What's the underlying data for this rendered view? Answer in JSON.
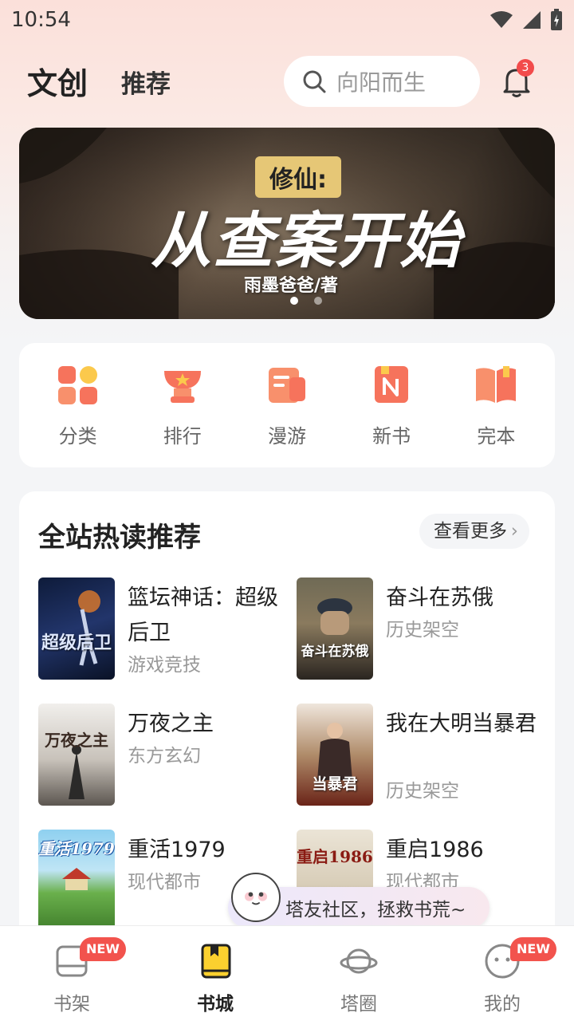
{
  "status_bar": {
    "time": "10:54"
  },
  "header": {
    "main_tab": "文创",
    "sub_tab": "推荐",
    "search_placeholder": "向阳而生",
    "notification_count": "3"
  },
  "banner": {
    "tag": "修仙:",
    "title": "从查案开始",
    "author": "雨墨爸爸/著",
    "page_count": 2,
    "active_page": 0
  },
  "categories": [
    {
      "label": "分类",
      "icon": "category-icon"
    },
    {
      "label": "排行",
      "icon": "trophy-icon"
    },
    {
      "label": "漫游",
      "icon": "roam-icon"
    },
    {
      "label": "新书",
      "icon": "new-book-icon"
    },
    {
      "label": "完本",
      "icon": "complete-book-icon"
    }
  ],
  "hot": {
    "title": "全站热读推荐",
    "more_label": "查看更多",
    "books": [
      {
        "name": "篮坛神话：超级后卫",
        "genre": "游戏竞技",
        "cover_text": "超级后卫"
      },
      {
        "name": "奋斗在苏俄",
        "genre": "历史架空",
        "cover_text": "奋斗在苏俄"
      },
      {
        "name": "万夜之主",
        "genre": "东方玄幻",
        "cover_text": "万夜之主"
      },
      {
        "name": "我在大明当暴君",
        "genre": "历史架空",
        "cover_text": "当暴君"
      },
      {
        "name": "重活1979",
        "genre": "现代都市",
        "cover_text": "重活1979"
      },
      {
        "name": "重启1986",
        "genre": "现代都市",
        "cover_text": "重启1986"
      }
    ]
  },
  "bubble": {
    "text": "塔友社区，拯救书荒~"
  },
  "nav": [
    {
      "label": "书架",
      "badge": "NEW"
    },
    {
      "label": "书城",
      "badge": ""
    },
    {
      "label": "塔圈",
      "badge": ""
    },
    {
      "label": "我的",
      "badge": "NEW"
    }
  ]
}
